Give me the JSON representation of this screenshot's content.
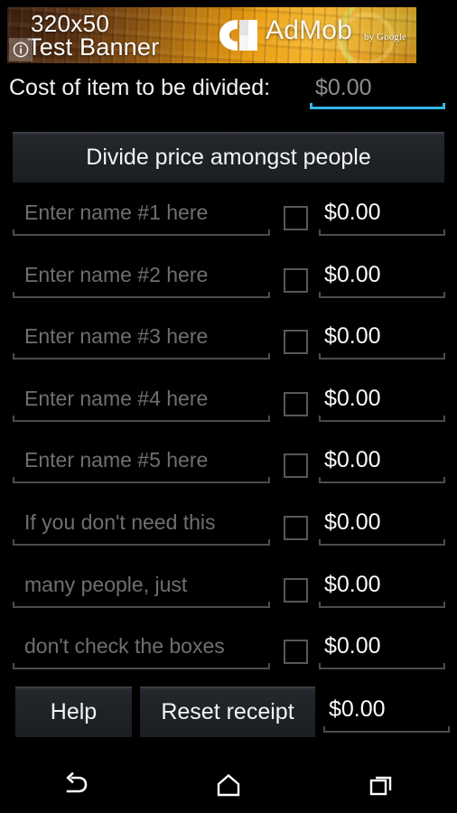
{
  "ad": {
    "title": "320x50",
    "subtitle": "Test Banner",
    "brand": "AdMob",
    "byline": "by Google",
    "info_icon": "info-icon",
    "logo_icon": "admob-logo-icon"
  },
  "cost": {
    "label": "Cost of item to be divided:",
    "value": "$0.00",
    "placeholder": "$0.00",
    "accent_color": "#33b5e5"
  },
  "divide_button": {
    "label": "Divide price amongst people"
  },
  "people": [
    {
      "name_placeholder": "Enter name #1 here",
      "checked": false,
      "amount": "$0.00"
    },
    {
      "name_placeholder": "Enter name #2 here",
      "checked": false,
      "amount": "$0.00"
    },
    {
      "name_placeholder": "Enter name #3 here",
      "checked": false,
      "amount": "$0.00"
    },
    {
      "name_placeholder": "Enter name #4 here",
      "checked": false,
      "amount": "$0.00"
    },
    {
      "name_placeholder": "Enter name #5 here",
      "checked": false,
      "amount": "$0.00"
    },
    {
      "name_placeholder": "If you don't need this",
      "checked": false,
      "amount": "$0.00"
    },
    {
      "name_placeholder": "many people, just",
      "checked": false,
      "amount": "$0.00"
    },
    {
      "name_placeholder": "don't check the boxes",
      "checked": false,
      "amount": "$0.00"
    }
  ],
  "footer": {
    "help_label": "Help",
    "reset_label": "Reset receipt",
    "total": "$0.00"
  },
  "navbar": {
    "back": "back-icon",
    "home": "home-icon",
    "recents": "recents-icon"
  },
  "theme": {
    "background": "#000000",
    "button_fill": "#1e2126",
    "hint_text": "#6f6f6f",
    "value_text": "#fbfbfb",
    "underline": "#4c4c4c"
  }
}
